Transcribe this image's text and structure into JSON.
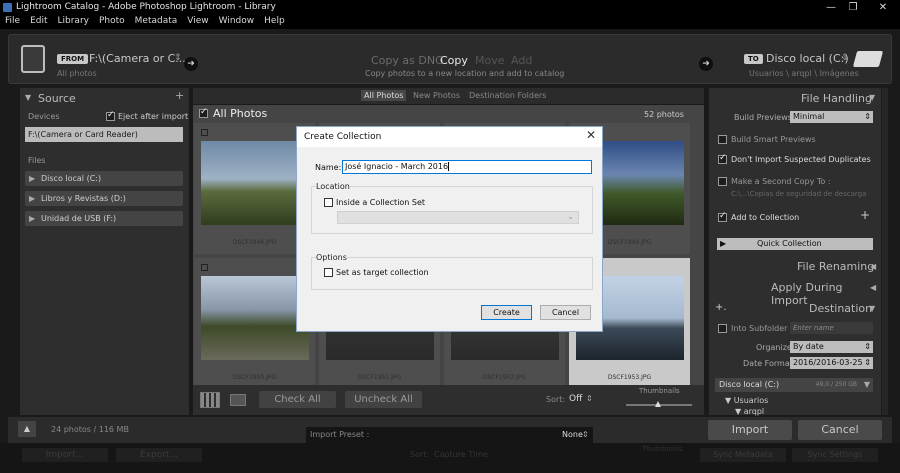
{
  "window": {
    "title": "Lightroom Catalog - Adobe Photoshop Lightroom - Library",
    "controls": [
      "—",
      "❐",
      "✕"
    ]
  },
  "menu": [
    "File",
    "Edit",
    "Library",
    "Photo",
    "Metadata",
    "View",
    "Window",
    "Help"
  ],
  "header": {
    "from_tag": "FROM",
    "from_path": "F:\\(Camera or C...",
    "from_sub": "All photos",
    "modes": [
      "Copy as DNG",
      "Copy",
      "Move",
      "Add"
    ],
    "active_mode": "Copy",
    "mode_desc": "Copy photos to a new location and add to catalog",
    "to_tag": "TO",
    "to_path": "Disco local (C:)",
    "to_sub": "Usuarios \\ arqpl \\ Imágenes"
  },
  "source": {
    "title": "Source",
    "devices_label": "Devices",
    "eject_label": "Eject after import",
    "device_selected": "F:\\(Camera or Card Reader)",
    "files_label": "Files",
    "drives": [
      "Disco local (C:)",
      "Libros y Revistas (D:)",
      "Unidad de USB (F:)"
    ]
  },
  "grid": {
    "tabs": [
      "All Photos",
      "New Photos",
      "Destination Folders"
    ],
    "all_photos_label": "All Photos",
    "count": "52 photos",
    "files": [
      "DSCF1946.JPG",
      "DSCF1949.JPG",
      "DSCF1950.JPG",
      "DSCF1951.JPG",
      "DSCF1952.JPG",
      "DSCF1953.JPG"
    ],
    "check_all": "Check All",
    "uncheck_all": "Uncheck All",
    "sort_label": "Sort:",
    "sort_value": "Off",
    "thumbnails_label": "Thumbnails"
  },
  "right": {
    "file_handling": "File Handling",
    "build_previews_label": "Build Previews",
    "build_previews_value": "Minimal",
    "smart_previews": "Build Smart Previews",
    "dont_import": "Don't Import Suspected Duplicates",
    "second_copy": "Make a Second Copy To :",
    "second_copy_path": "C:\\...\\Copias de seguridad de descarga",
    "add_to_collection": "Add to Collection",
    "quick_collection": "Quick Collection",
    "file_renaming": "File Renaming",
    "apply_during_import": "Apply During Import",
    "destination": "Destination",
    "into_subfolder": "Into Subfolder",
    "enter_name": "Enter name",
    "organize_label": "Organize",
    "organize_value": "By date",
    "date_format_label": "Date Format",
    "date_format_value": "2016/2016-03-25",
    "disk": "Disco local (C:)",
    "disk_size": "49,0 / 250 GB",
    "folder": "Usuarios",
    "subfolder": "arqpl"
  },
  "bottom": {
    "summary": "24 photos / 116 MB",
    "preset_label": "Import Preset :",
    "preset_value": "None",
    "import": "Import",
    "cancel": "Cancel",
    "filmstrip_labels": [
      "Import...",
      "Export...",
      "Sort:",
      "Capture Time",
      "Thumbnails",
      "Sync Metadata",
      "Sync Settings"
    ]
  },
  "dialog": {
    "title": "Create Collection",
    "name_label": "Name:",
    "name_value": "José Ignacio - March 2016",
    "location_label": "Location",
    "inside_set_label": "Inside a Collection Set",
    "options_label": "Options",
    "target_label": "Set as target collection",
    "create": "Create",
    "cancel": "Cancel"
  }
}
